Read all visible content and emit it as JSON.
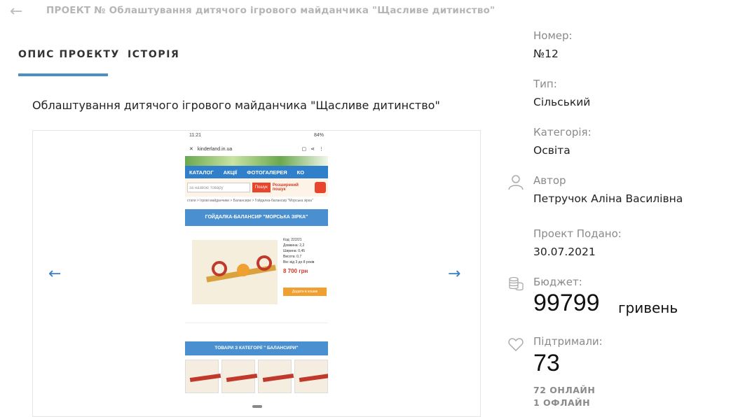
{
  "header": {
    "breadcrumb": "ПРОЕКТ № Облаштування дитячого ігрового майданчика \"Щасливе дитинство\""
  },
  "tabs": [
    {
      "label": "ОПИС ПРОЕКТУ",
      "active": true
    },
    {
      "label": "ІСТОРІЯ",
      "active": false
    }
  ],
  "description": "Облаштування дитячого ігрового майданчика \"Щасливе дитинство\"",
  "gallery": {
    "screenshot": {
      "status_time": "11:21",
      "status_battery": "84%",
      "url": "kinderland.in.ua",
      "nav": [
        "КАТАЛОГ",
        "АКЦІЇ",
        "ФОТОГАЛЕРЕЯ",
        "КО"
      ],
      "search_placeholder": "за назвою товару",
      "search_button": "Пошук",
      "extended_search": "Розширений пошук",
      "path": "стати > Ігрові майданчики > Балансири > Гойдалка-балансир \"Морська зірка\"",
      "product_title": "ГОЙДАЛКА-БАЛАНСИР \"МОРСЬКА ЗІРКА\"",
      "specs": [
        "Код: 222/21",
        "Довжина: 2,2",
        "Ширина: 0,45",
        "Висота: 0,7",
        "Вік: від 3 до 8 років"
      ],
      "price": "8 700 грн",
      "buy_button": "Додати в кошик",
      "category_title": "ТОВАРИ З КАТЕГОРІЇ \" БАЛАНСИРИ\""
    }
  },
  "meta": {
    "number_label": "Номер:",
    "number_value": "№12",
    "type_label": "Тип:",
    "type_value": "Сільський",
    "category_label": "Категорія:",
    "category_value": "Освіта",
    "author_label": "Автор",
    "author_value": "Петручок Аліна Василівна",
    "submitted_label": "Проект Подано:",
    "submitted_value": "30.07.2021",
    "budget_label": "Бюджет:",
    "budget_value": "99799",
    "budget_unit": "гривень",
    "supported_label": "Підтримали:",
    "supported_value": "73",
    "online": "72 ОНЛАЙН",
    "offline": "1 ОФЛАЙН"
  },
  "colors": {
    "accent": "#4a90c6",
    "muted": "#8a8a8a"
  }
}
